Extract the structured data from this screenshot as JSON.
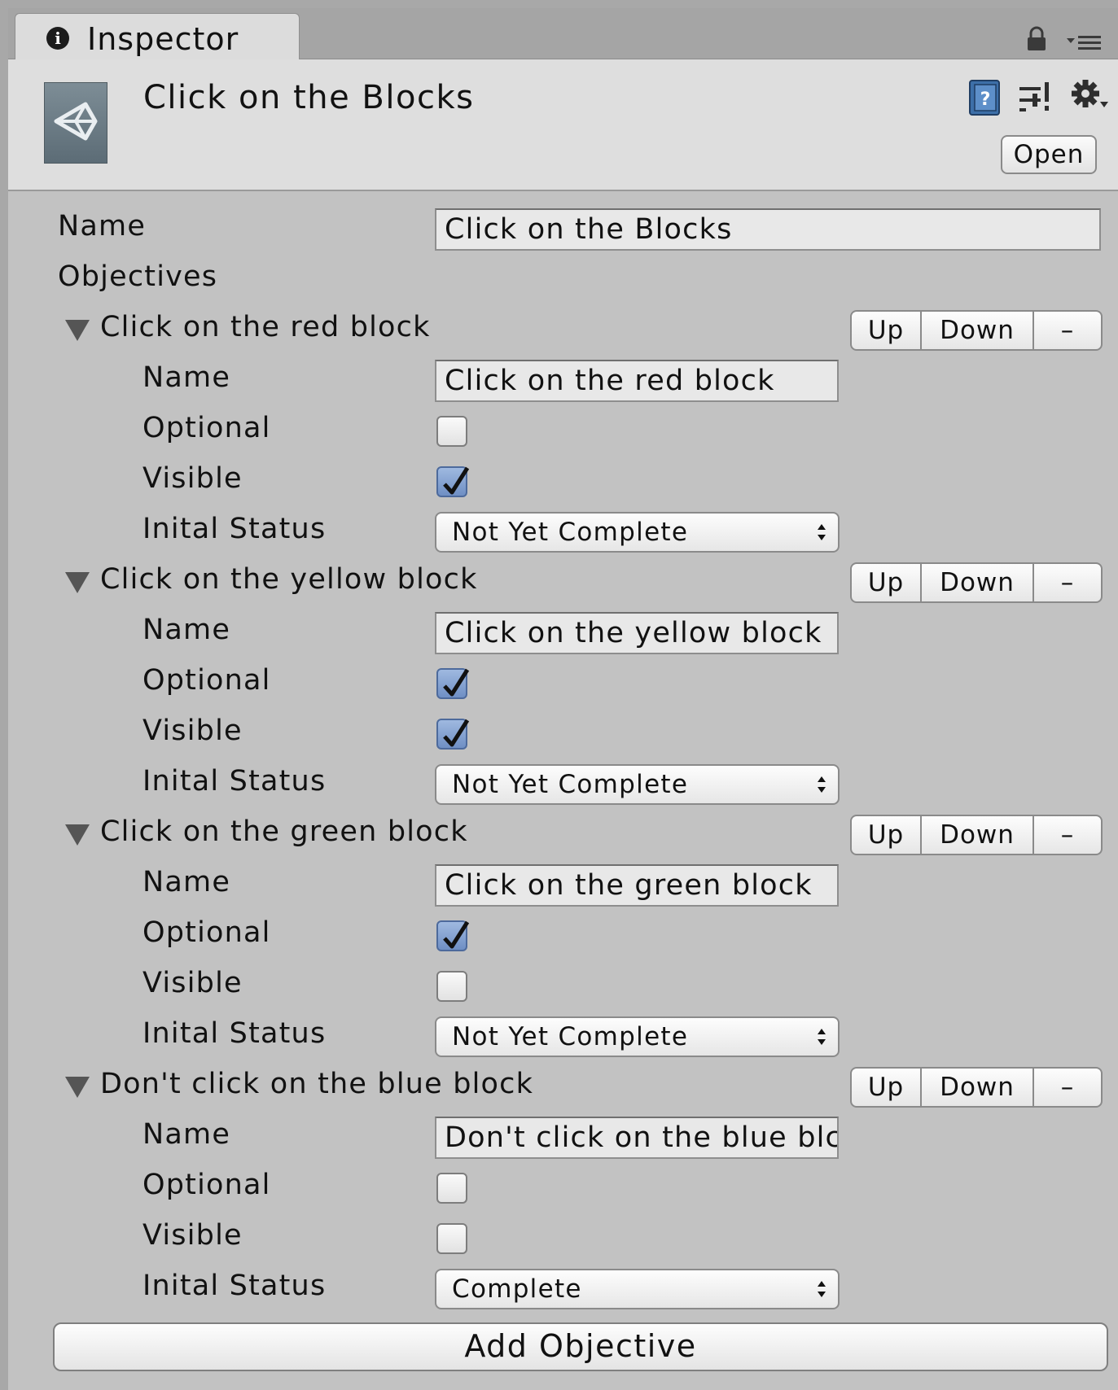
{
  "tab": {
    "label": "Inspector"
  },
  "header": {
    "title": "Click on the Blocks",
    "open_label": "Open"
  },
  "name_field": {
    "label": "Name",
    "value": "Click on the Blocks"
  },
  "objectives_label": "Objectives",
  "buttons": {
    "up": "Up",
    "down": "Down",
    "remove": "–"
  },
  "field_labels": {
    "name": "Name",
    "optional": "Optional",
    "visible": "Visible",
    "status": "Inital Status"
  },
  "objectives": [
    {
      "title": "Click on the red block",
      "name": "Click on the red block",
      "optional": false,
      "visible": true,
      "status": "Not Yet Complete"
    },
    {
      "title": "Click on the yellow block",
      "name": "Click on the yellow block",
      "optional": true,
      "visible": true,
      "status": "Not Yet Complete"
    },
    {
      "title": "Click on the green block",
      "name": "Click on the green block",
      "optional": true,
      "visible": false,
      "status": "Not Yet Complete"
    },
    {
      "title": "Don't click on the blue block",
      "name": "Don't click on the blue blc",
      "optional": false,
      "visible": false,
      "status": "Complete"
    }
  ],
  "add_objective_label": "Add Objective"
}
